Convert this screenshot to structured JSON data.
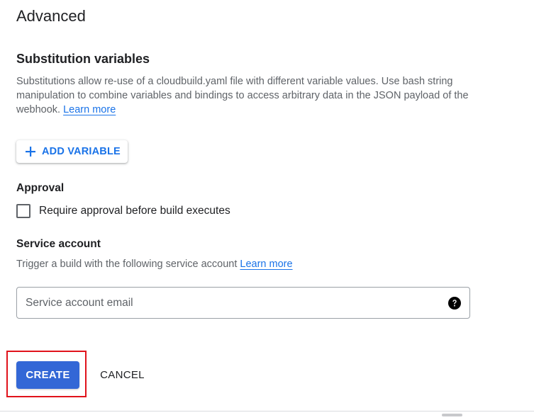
{
  "advanced": {
    "title": "Advanced"
  },
  "substitution": {
    "title": "Substitution variables",
    "description": "Substitutions allow re-use of a cloudbuild.yaml file with different variable values. Use bash string manipulation to combine variables and bindings to access arbitrary data in the JSON payload of the webhook.",
    "learn_more": "Learn more",
    "add_variable_label": "ADD VARIABLE",
    "add_icon": "plus-icon"
  },
  "approval": {
    "title": "Approval",
    "checkbox_label": "Require approval before build executes",
    "checked": false
  },
  "service_account": {
    "title": "Service account",
    "description": "Trigger a build with the following service account",
    "learn_more": "Learn more",
    "email_placeholder": "Service account email",
    "email_value": "",
    "help_icon": "help-circle-icon"
  },
  "actions": {
    "create_label": "CREATE",
    "cancel_label": "CANCEL"
  },
  "colors": {
    "accent": "#1a73e8",
    "primary_button": "#3367d6",
    "highlight": "#e0121b",
    "text": "#202124",
    "secondary_text": "#5f6368"
  }
}
